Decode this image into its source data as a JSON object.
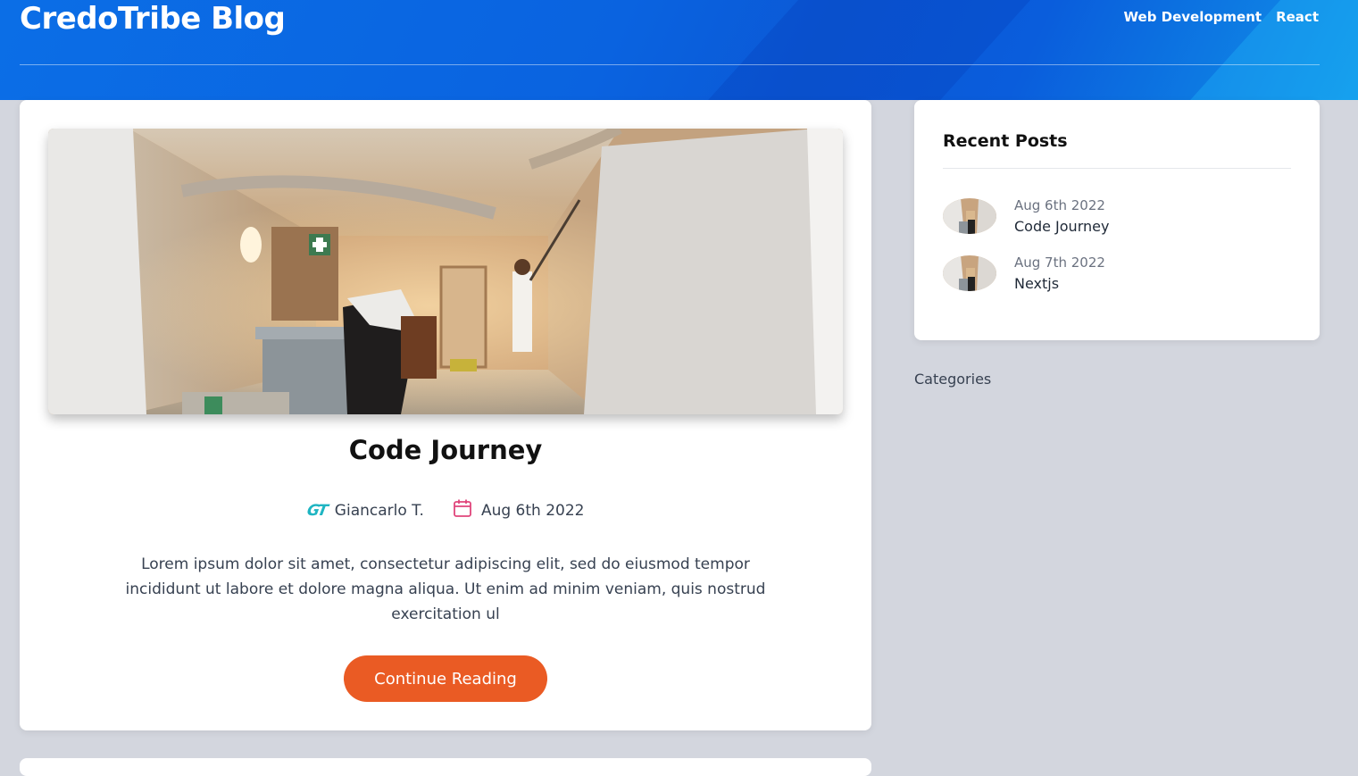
{
  "site": {
    "title": "CredoTribe Blog",
    "nav": [
      "Web Development",
      "React"
    ]
  },
  "post": {
    "title": "Code Journey",
    "author": "Giancarlo T.",
    "author_logo": "GT",
    "date": "Aug 6th 2022",
    "excerpt": "Lorem ipsum dolor sit amet, consectetur adipiscing elit, sed do eiusmod tempor incididunt ut labore et dolore magna aliqua. Ut enim ad minim veniam, quis nostrud exercitation ul",
    "cta_label": "Continue Reading",
    "image_icon": "construction-photo"
  },
  "sidebar": {
    "recent_title": "Recent Posts",
    "recent_posts": [
      {
        "date": "Aug 6th 2022",
        "title": "Code Journey"
      },
      {
        "date": "Aug 7th 2022",
        "title": "Nextjs"
      }
    ],
    "categories_title": "Categories"
  },
  "colors": {
    "header_blue": "#0b63e0",
    "accent_orange": "#ea5b24",
    "author_teal": "#1fb5c2",
    "calendar_pink": "#e0457b",
    "page_bg": "#d3d6de"
  }
}
